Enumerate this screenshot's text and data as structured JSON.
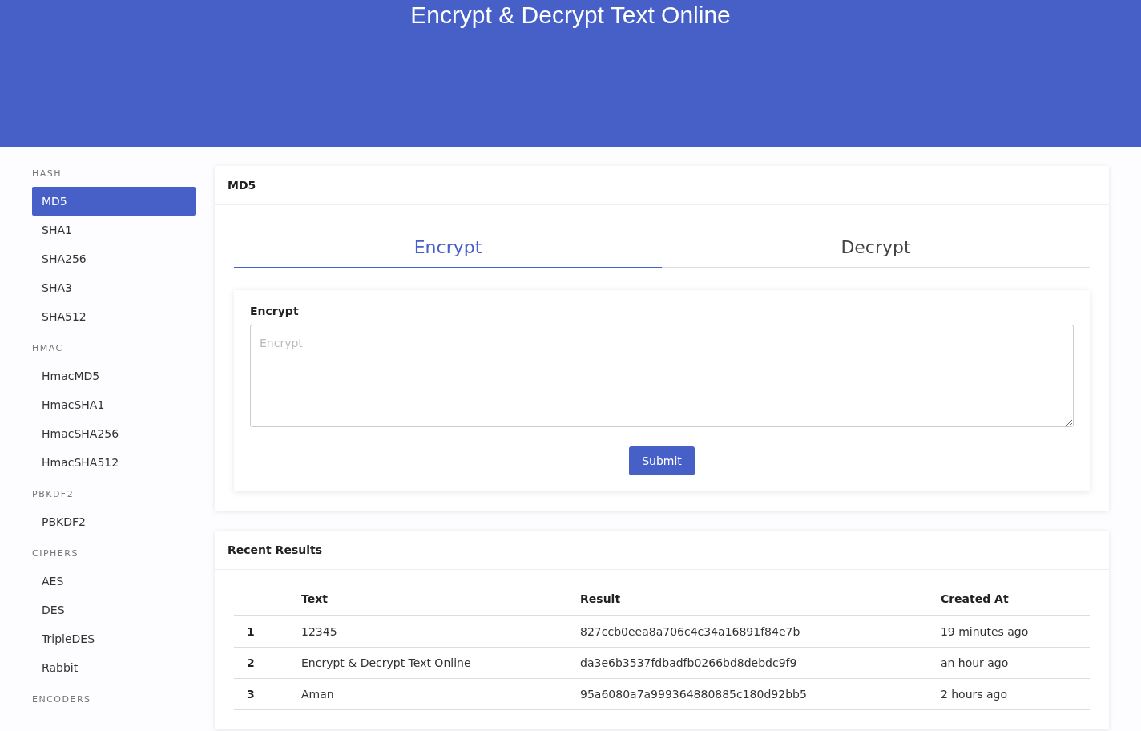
{
  "header": {
    "title": "Encrypt & Decrypt Text Online"
  },
  "sidebar": {
    "sections": [
      {
        "label": "HASH",
        "items": [
          {
            "label": "MD5",
            "selected": true
          },
          {
            "label": "SHA1",
            "selected": false
          },
          {
            "label": "SHA256",
            "selected": false
          },
          {
            "label": "SHA3",
            "selected": false
          },
          {
            "label": "SHA512",
            "selected": false
          }
        ]
      },
      {
        "label": "HMAC",
        "items": [
          {
            "label": "HmacMD5",
            "selected": false
          },
          {
            "label": "HmacSHA1",
            "selected": false
          },
          {
            "label": "HmacSHA256",
            "selected": false
          },
          {
            "label": "HmacSHA512",
            "selected": false
          }
        ]
      },
      {
        "label": "PBKDF2",
        "items": [
          {
            "label": "PBKDF2",
            "selected": false
          }
        ]
      },
      {
        "label": "CIPHERS",
        "items": [
          {
            "label": "AES",
            "selected": false
          },
          {
            "label": "DES",
            "selected": false
          },
          {
            "label": "TripleDES",
            "selected": false
          },
          {
            "label": "Rabbit",
            "selected": false
          }
        ]
      },
      {
        "label": "ENCODERS"
      }
    ]
  },
  "algorithm_card": {
    "title": "MD5",
    "tabs": [
      {
        "label": "Encrypt",
        "selected": true
      },
      {
        "label": "Decrypt",
        "selected": false
      }
    ],
    "form": {
      "title": "Encrypt",
      "placeholder": "Encrypt",
      "button": "Submit"
    }
  },
  "results_card": {
    "title": "Recent Results",
    "table": {
      "columns": [
        "",
        "Text",
        "Result",
        "Created At"
      ],
      "rows": [
        [
          "1",
          "12345",
          "827ccb0eea8a706c4c34a16891f84e7b",
          "19 minutes ago"
        ],
        [
          "2",
          "Encrypt & Decrypt Text Online",
          "da3e6b3537fdbadfb0266bd8debdc9f9",
          "an hour ago"
        ],
        [
          "3",
          "Aman",
          "95a6080a7a999364880885c180d92bb5",
          "2 hours ago"
        ]
      ]
    }
  }
}
